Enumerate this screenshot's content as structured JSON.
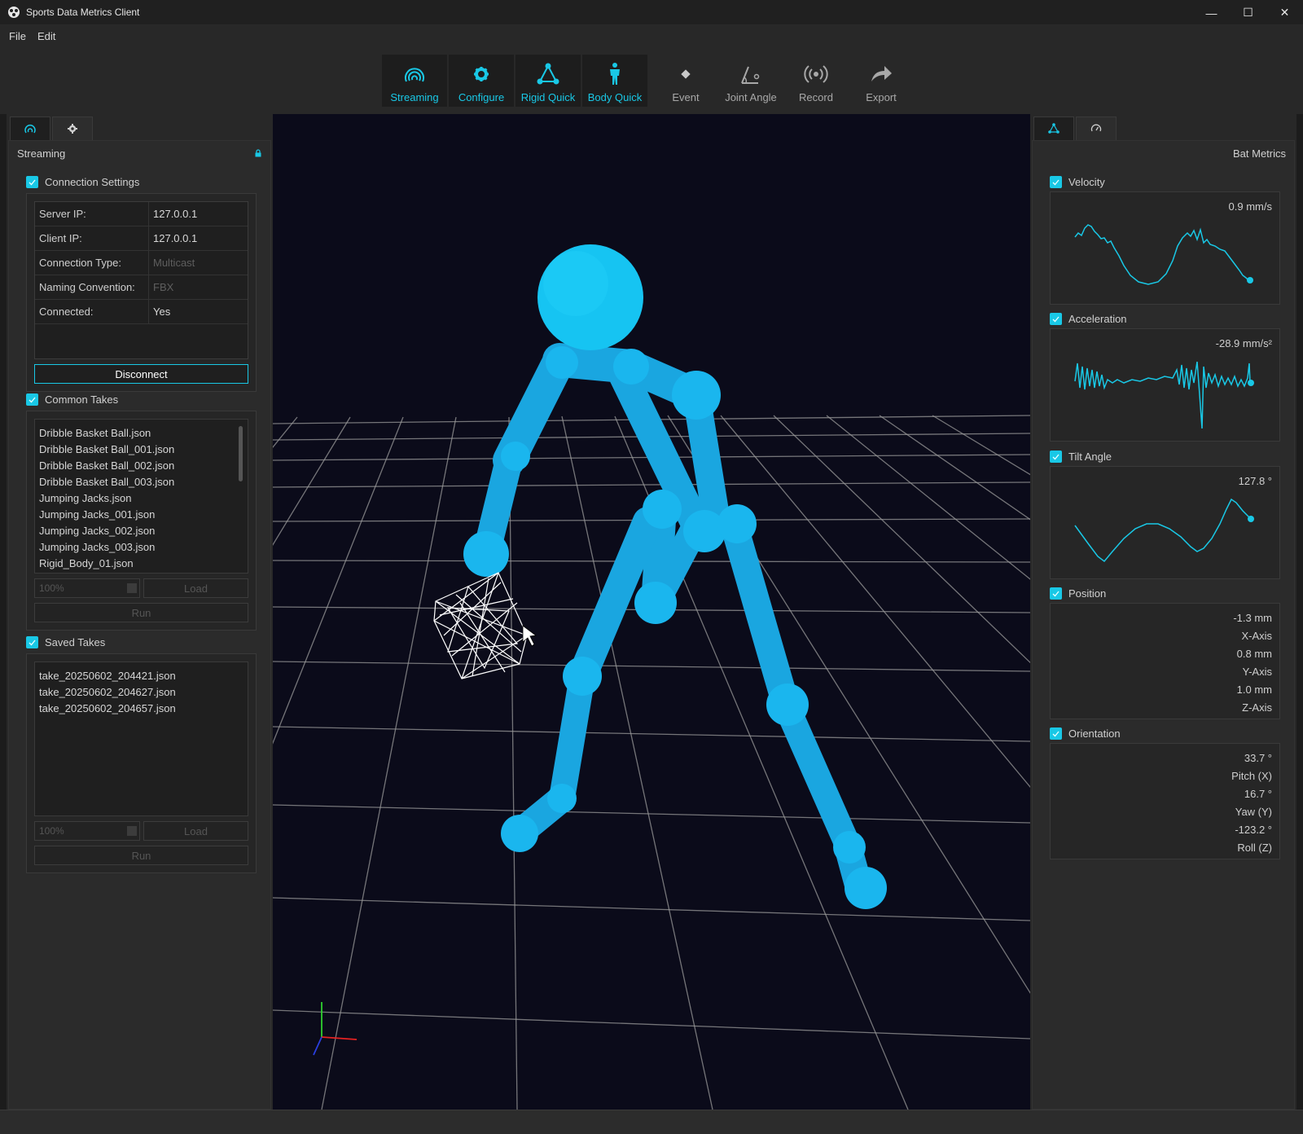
{
  "window": {
    "title": "Sports Data Metrics Client",
    "minimize": "—",
    "maximize": "☐",
    "close": "✕"
  },
  "menu": [
    "File",
    "Edit"
  ],
  "toolbar": {
    "active_tools": [
      {
        "label": "Streaming",
        "icon": "streaming-icon"
      },
      {
        "label": "Configure",
        "icon": "gear-icon"
      },
      {
        "label": "Rigid Quick",
        "icon": "rigid-body-icon"
      },
      {
        "label": "Body Quick",
        "icon": "body-icon"
      }
    ],
    "tools": [
      {
        "label": "Event",
        "icon": "diamond-icon"
      },
      {
        "label": "Joint Angle",
        "icon": "angle-icon"
      },
      {
        "label": "Record",
        "icon": "broadcast-icon"
      },
      {
        "label": "Export",
        "icon": "export-arrow-icon"
      }
    ]
  },
  "left_panel": {
    "header": "Streaming",
    "connection": {
      "title": "Connection Settings",
      "rows": [
        {
          "key": "Server IP:",
          "value": "127.0.0.1",
          "dim": false
        },
        {
          "key": "Client IP:",
          "value": "127.0.0.1",
          "dim": false
        },
        {
          "key": "Connection Type:",
          "value": "Multicast",
          "dim": true
        },
        {
          "key": "Naming Convention:",
          "value": "FBX",
          "dim": true
        },
        {
          "key": "Connected:",
          "value": "Yes",
          "dim": false
        }
      ],
      "disconnect_label": "Disconnect"
    },
    "common_takes": {
      "title": "Common Takes",
      "items": [
        "Dribble Basket Ball.json",
        "Dribble Basket Ball_001.json",
        "Dribble Basket Ball_002.json",
        "Dribble Basket Ball_003.json",
        "Jumping Jacks.json",
        "Jumping Jacks_001.json",
        "Jumping Jacks_002.json",
        "Jumping Jacks_003.json",
        "Rigid_Body_01.json"
      ],
      "speed": "100%",
      "load_label": "Load",
      "run_label": "Run"
    },
    "saved_takes": {
      "title": "Saved Takes",
      "items": [
        "take_20250602_204421.json",
        "take_20250602_204627.json",
        "take_20250602_204657.json"
      ],
      "speed": "100%",
      "load_label": "Load",
      "run_label": "Run"
    }
  },
  "right_panel": {
    "header": "Bat Metrics",
    "velocity": {
      "title": "Velocity",
      "value": "0.9 mm/s"
    },
    "acceleration": {
      "title": "Acceleration",
      "value": "-28.9 mm/s²"
    },
    "tilt": {
      "title": "Tilt Angle",
      "value": "127.8 °"
    },
    "position": {
      "title": "Position",
      "x_value": "-1.3 mm",
      "x_label": "X-Axis",
      "y_value": "0.8 mm",
      "y_label": "Y-Axis",
      "z_value": "1.0 mm",
      "z_label": "Z-Axis"
    },
    "orientation": {
      "title": "Orientation",
      "pitch_value": "33.7 °",
      "pitch_label": "Pitch (X)",
      "yaw_value": "16.7 °",
      "yaw_label": "Yaw (Y)",
      "roll_value": "-123.2 °",
      "roll_label": "Roll (Z)"
    }
  },
  "colors": {
    "accent": "#19c8e6",
    "skeleton": "#1aa6e0",
    "viewport_bg": "#0b0b1a",
    "panel_bg": "#2b2b2b"
  }
}
